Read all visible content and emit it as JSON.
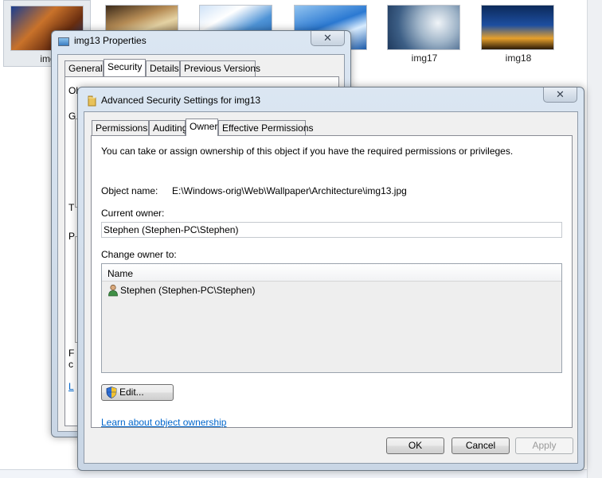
{
  "explorer": {
    "thumbnails": [
      {
        "caption": "img"
      },
      {
        "caption": ""
      },
      {
        "caption": ""
      },
      {
        "caption": ""
      },
      {
        "caption": "img17"
      },
      {
        "caption": "img18"
      }
    ]
  },
  "properties_window": {
    "title": "img13 Properties",
    "close_glyph": "✕",
    "tabs": [
      "General",
      "Security",
      "Details",
      "Previous Versions"
    ],
    "peek_text": {
      "line1": "Obje",
      "line2": "G",
      "line3": "T",
      "line4": "P",
      "line5": "F",
      "line6": "c",
      "line7": "L"
    }
  },
  "advanced_window": {
    "title": "Advanced Security Settings for img13",
    "close_glyph": "✕",
    "tabs": [
      "Permissions",
      "Auditing",
      "Owner",
      "Effective Permissions"
    ],
    "owner_tab": {
      "intro": "You can take or assign ownership of this object if you have the required permissions or privileges.",
      "object_name_label": "Object name:",
      "object_name_value": "E:\\Windows-orig\\Web\\Wallpaper\\Architecture\\img13.jpg",
      "current_owner_label": "Current owner:",
      "current_owner_value": "Stephen (Stephen-PC\\Stephen)",
      "change_owner_label": "Change owner to:",
      "list_header_name": "Name",
      "list_items": [
        "Stephen (Stephen-PC\\Stephen)"
      ],
      "edit_button": "Edit...",
      "learn_link": "Learn about object ownership"
    },
    "buttons": {
      "ok": "OK",
      "cancel": "Cancel",
      "apply": "Apply"
    }
  }
}
